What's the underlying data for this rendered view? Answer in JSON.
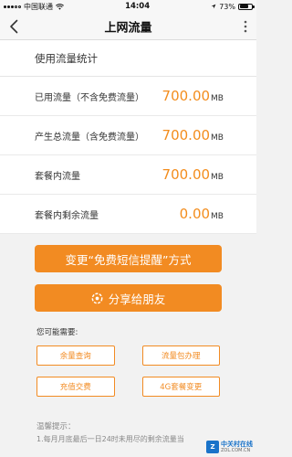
{
  "status_bar": {
    "carrier": "中国联通",
    "time": "14:04",
    "battery": "73%",
    "battery_level": 0.73
  },
  "nav": {
    "title": "上网流量"
  },
  "section": {
    "title": "使用流量统计"
  },
  "stats": [
    {
      "label": "已用流量（不含免费流量）",
      "value": "700.00",
      "unit": "MB"
    },
    {
      "label": "产生总流量（含免费流量）",
      "value": "700.00",
      "unit": "MB"
    },
    {
      "label": "套餐内流量",
      "value": "700.00",
      "unit": "MB"
    },
    {
      "label": "套餐内剩余流量",
      "value": "0.00",
      "unit": "MB"
    }
  ],
  "buttons": {
    "change_method": "变更“免费短信提醒”方式",
    "share": "分享给朋友"
  },
  "maybe_needed": {
    "title": "您可能需要:",
    "options": [
      "余量查询",
      "流量包办理",
      "充值交费",
      "4G套餐变更"
    ]
  },
  "tips": {
    "title": "温馨提示：",
    "line1": "1.每月月底最后一日24时未用尽的剩余流量当"
  },
  "watermark": {
    "cn": "中关村在线",
    "en": "ZOL.COM.CN"
  },
  "colors": {
    "accent": "#f28b22",
    "value": "#f38d1d"
  }
}
